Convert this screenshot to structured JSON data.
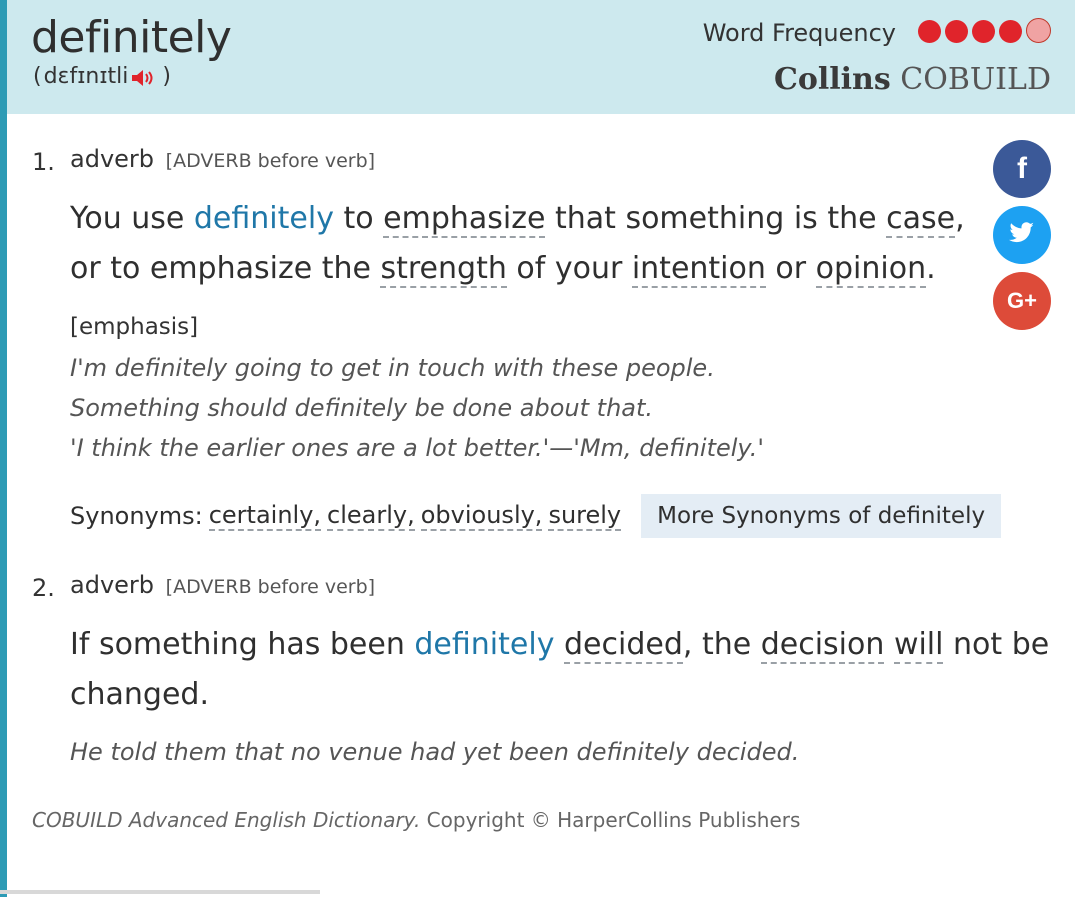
{
  "entry": {
    "headword": "definitely",
    "pronunciation_open": "(",
    "pronunciation": "dɛfɪnɪtli",
    "pronunciation_close": ")",
    "speaker_icon": "speaker-icon"
  },
  "frequency": {
    "label": "Word Frequency",
    "filled_dots": 4,
    "total_dots": 5,
    "filled_color": "#e0242b",
    "empty_color": "#f0a3a3"
  },
  "brand": {
    "bold": "Collins",
    "light": "COBUILD"
  },
  "senses": [
    {
      "number": "1.",
      "pos": "adverb",
      "grammar": "[ADVERB before verb]",
      "definition_parts": [
        "You use ",
        "definitely",
        " to ",
        "emphasize",
        " that something is the ",
        "case",
        ",",
        "or to emphasize the ",
        "strength",
        " of your ",
        "intention",
        " or ",
        "opinion",
        "."
      ],
      "label": "[emphasis]",
      "examples": [
        "I'm definitely going to get in touch with these people.",
        "Something should definitely be done about that.",
        "'I think the earlier ones are a lot better.'—'Mm, definitely.'"
      ],
      "synonyms_label": "Synonyms:",
      "synonyms": [
        "certainly,",
        "clearly,",
        "obviously,",
        "surely"
      ],
      "more_synonyms": "More Synonyms of definitely"
    },
    {
      "number": "2.",
      "pos": "adverb",
      "grammar": "[ADVERB before verb]",
      "definition_parts": [
        "If something has been ",
        "definitely",
        " ",
        "decided",
        ", the ",
        "decision",
        " ",
        "will",
        " not be",
        "changed."
      ],
      "examples": [
        "He told them that no venue had yet been definitely decided."
      ]
    }
  ],
  "social": {
    "facebook": {
      "icon": "facebook-icon",
      "color": "#3b5998",
      "glyph": "f"
    },
    "twitter": {
      "icon": "twitter-icon",
      "color": "#1da1f2"
    },
    "google": {
      "icon": "google-plus-icon",
      "color": "#dd4b39",
      "glyph": "G+"
    }
  },
  "footer": {
    "source": "COBUILD Advanced English Dictionary.",
    "copyright": " Copyright © HarperCollins Publishers"
  }
}
